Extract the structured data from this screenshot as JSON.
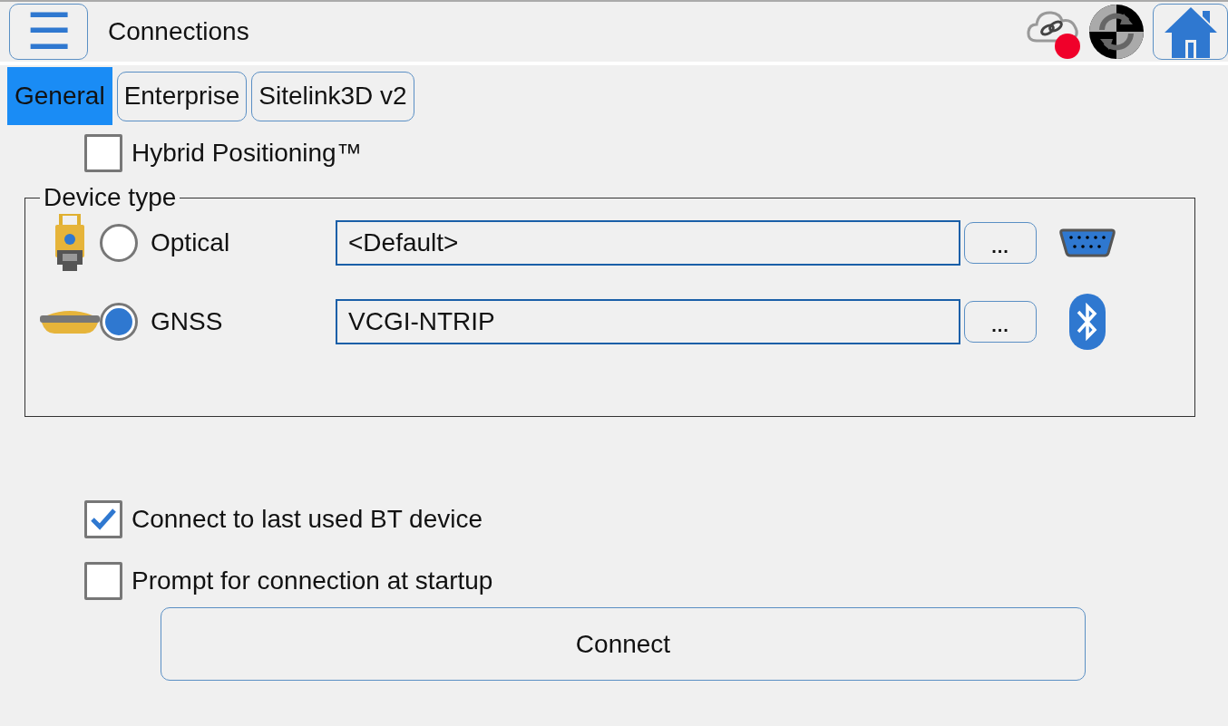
{
  "header": {
    "title": "Connections",
    "menu_button": "☰"
  },
  "tabs": [
    {
      "label": "General",
      "selected": true
    },
    {
      "label": "Enterprise",
      "selected": false
    },
    {
      "label": "Sitelink3D v2",
      "selected": false
    }
  ],
  "hybrid_positioning": {
    "label": "Hybrid Positioning™",
    "checked": false
  },
  "device_type": {
    "legend": "Device type",
    "devices": [
      {
        "kind": "optical",
        "label": "Optical",
        "selected": false,
        "value": "<Default>",
        "browse": "...",
        "connection": {
          "kind": "serial"
        }
      },
      {
        "kind": "gnss",
        "label": "GNSS",
        "selected": true,
        "value": "VCGI-NTRIP",
        "browse": "...",
        "connection": {
          "kind": "bluetooth"
        }
      }
    ]
  },
  "options": [
    {
      "label": "Connect to last used BT device",
      "checked": true
    },
    {
      "label": "Prompt for connection at startup",
      "checked": false
    }
  ],
  "connect_button": "Connect"
}
